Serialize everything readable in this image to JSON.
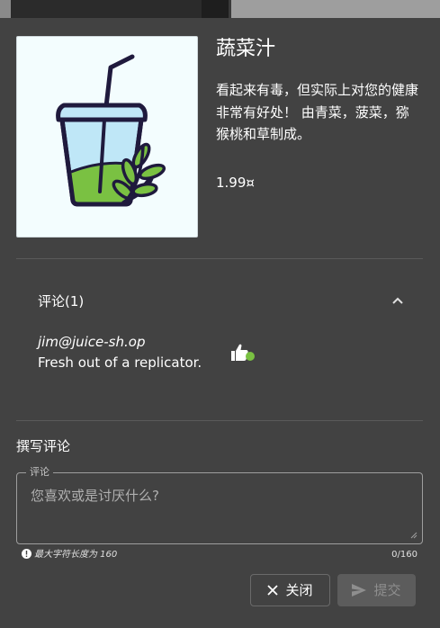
{
  "product": {
    "name": "蔬菜汁",
    "description": "看起来有毒，但实际上对您的健康非常有好处！ 由青菜，菠菜，猕猴桃和草制成。",
    "price": "1.99¤",
    "image_icon": "green-smoothie-cup-icon"
  },
  "reviews": {
    "header": "评论(1)",
    "items": [
      {
        "author": "jim@juice-sh.op",
        "text": "Fresh out of a replicator."
      }
    ]
  },
  "write_review": {
    "title": "撰写评论",
    "field_label": "评论",
    "placeholder": "您喜欢或是讨厌什么?",
    "value": "",
    "hint": "最大字符长度为 160",
    "counter": "0/160"
  },
  "actions": {
    "close_label": "关闭",
    "submit_label": "提交"
  },
  "colors": {
    "dialog_background": "#424242",
    "accent_green": "#7ac142"
  }
}
